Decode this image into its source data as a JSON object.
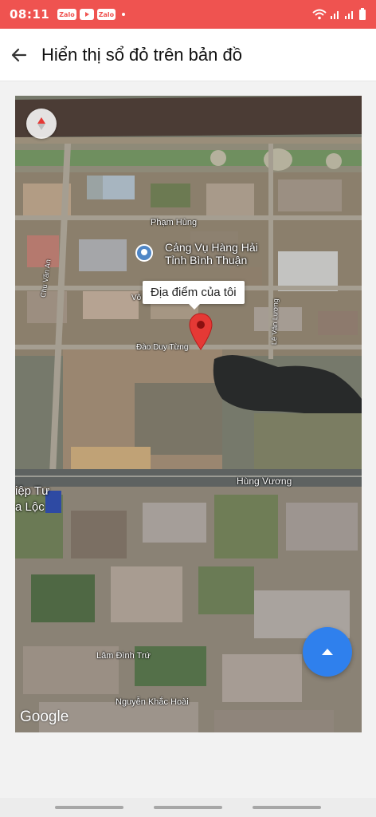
{
  "status_bar": {
    "time": "08:11",
    "apps": [
      "Zalo",
      "YouTube",
      "Zalo"
    ],
    "icons": [
      "wifi-icon",
      "signal-icon",
      "signal-icon",
      "battery-icon"
    ],
    "color": "#ef5350"
  },
  "appbar": {
    "back_icon": "arrow-left-icon",
    "title": "Hiển thị sổ đỏ trên bản đồ"
  },
  "map": {
    "callout": "Địa điểm của tôi",
    "poi_line1": "Cảng Vụ Hàng Hải",
    "poi_line2": "Tỉnh Bình Thuận",
    "edge_line1": "iệp Tư",
    "edge_line2": "a Lộc",
    "streets": {
      "pham_hung": "Phạm Hùng",
      "vo_van": "Võ V",
      "dao_duy_tung": "Đào Duy Từng",
      "chu_van_an": "Chu Văn An",
      "le_van_luong": "Lê Văn Lương",
      "hung_vuong": "Hùng Vương",
      "lam_dinh_tru": "Lâm Đình Trứ",
      "nguyen_khac_hoai": "Nguyễn Khắc Hoài"
    },
    "attribution": "Google",
    "compass_icon": "compass-icon",
    "pin_icon": "location-pin-icon",
    "fab_icon": "caret-up-icon",
    "accent": "#2f80ed"
  }
}
